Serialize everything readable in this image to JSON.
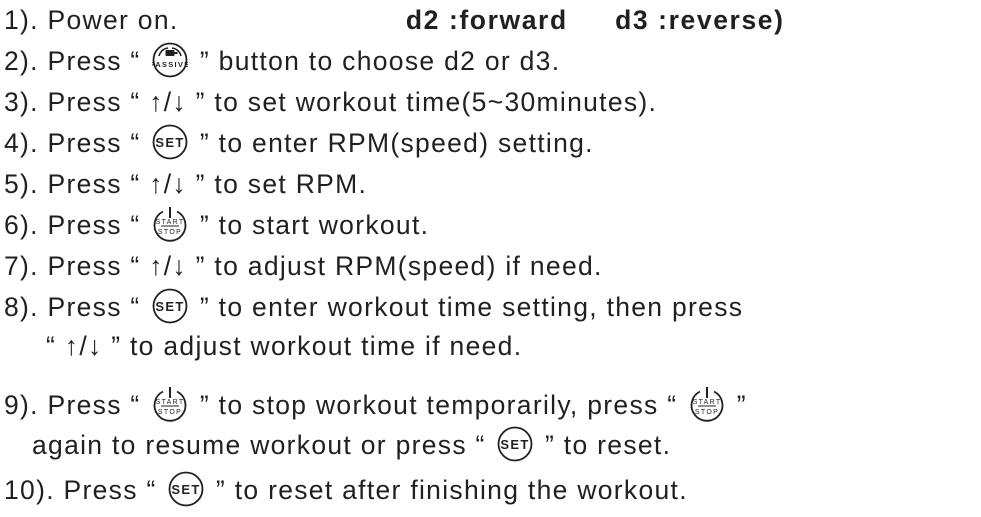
{
  "lines": [
    {
      "num": "1).",
      "text": "Power on."
    },
    {
      "num": "2).",
      "pre": "Press “",
      "post": "” button to choose d2 or d3."
    },
    {
      "num": "3).",
      "pre": "Press “",
      "arrows": "↑/↓",
      "post": "” to set workout time(5~30minutes)."
    },
    {
      "num": "4).",
      "pre": "Press “",
      "post": "” to enter RPM(speed) setting."
    },
    {
      "num": "5).",
      "pre": "Press “",
      "arrows": "↑/↓",
      "post": "” to set RPM."
    },
    {
      "num": "6).",
      "pre": "Press “",
      "post": "” to start workout."
    },
    {
      "num": "7).",
      "pre": "Press “",
      "arrows": "↑/↓",
      "post": "” to adjust RPM(speed) if need."
    },
    {
      "num": "8).",
      "pre": "Press “",
      "post": "” to enter workout time setting, then press"
    },
    {
      "pre": "“",
      "arrows": "↑/↓",
      "post": "” to adjust workout time if need."
    },
    {
      "num": "9).",
      "pre": "Press “",
      "mid": "” to stop workout temporarily, press “",
      "post": "”"
    },
    {
      "pre": "again to resume workout or press “",
      "post": "” to reset."
    },
    {
      "num": "10).",
      "pre": "Press “",
      "post": "” to reset after finishing the workout."
    }
  ],
  "header_note": {
    "forward": "d2 :forward",
    "reverse": "d3 :reverse)"
  },
  "buttons": {
    "passive": "PASSIVE",
    "set": "SET",
    "start": "START",
    "stop": "STOP"
  },
  "icons": {
    "passive": "passive-motor-icon",
    "set": "set-button-icon",
    "start_stop": "start-stop-button-icon"
  }
}
